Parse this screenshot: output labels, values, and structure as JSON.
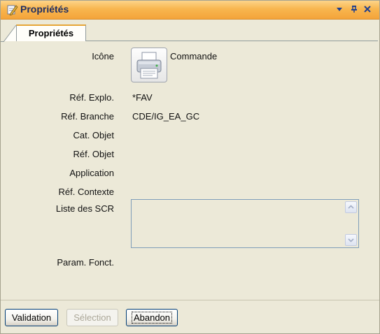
{
  "window": {
    "title": "Propriétés",
    "controls": {
      "dropdown": "▾",
      "pin": "ᵖ",
      "close": "✕"
    }
  },
  "tabs": [
    {
      "label": "Propriétés",
      "selected": true
    }
  ],
  "properties": {
    "icon": {
      "label": "Icône",
      "value": "Commande",
      "icon_name": "printer-icon"
    },
    "ref_explo": {
      "label": "Réf. Explo.",
      "value": "*FAV"
    },
    "ref_branche": {
      "label": "Réf. Branche",
      "value": "CDE/IG_EA_GC"
    },
    "cat_objet": {
      "label": "Cat. Objet",
      "value": ""
    },
    "ref_objet": {
      "label": "Réf. Objet",
      "value": ""
    },
    "application": {
      "label": "Application",
      "value": ""
    },
    "ref_contexte": {
      "label": "Réf. Contexte",
      "value": ""
    },
    "liste_scr": {
      "label": "Liste des SCR",
      "items": []
    },
    "param_fonct": {
      "label": "Param. Fonct.",
      "value": ""
    }
  },
  "buttons": {
    "validation": {
      "label": "Validation",
      "enabled": true
    },
    "selection": {
      "label": "Sélection",
      "enabled": false
    },
    "abandon": {
      "label": "Abandon",
      "enabled": true,
      "focused": true
    }
  },
  "colors": {
    "titlebar": "#f8b64f",
    "title_text": "#1f2f63",
    "background": "#ece9d8",
    "tab_accent": "#e7a537"
  }
}
